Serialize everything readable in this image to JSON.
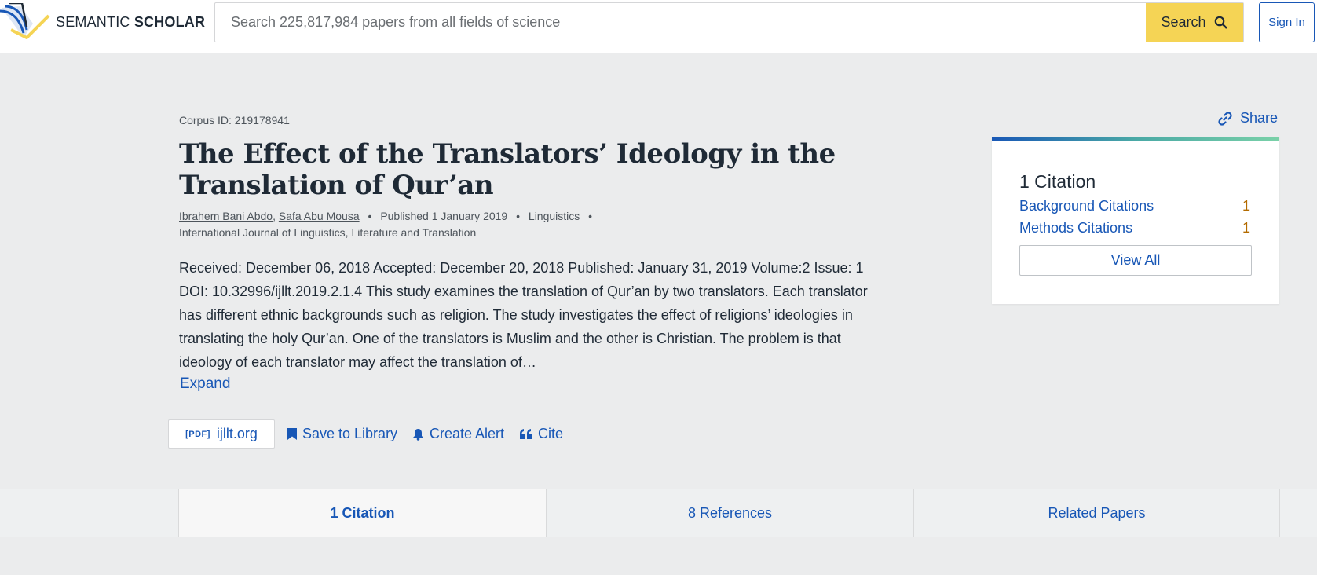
{
  "header": {
    "logo_text_light": "SEMANTIC ",
    "logo_text_bold": "SCHOLAR",
    "search_placeholder": "Search 225,817,984 papers from all fields of science",
    "search_button": "Search",
    "signin_button": "Sign In"
  },
  "paper": {
    "corpus_id": "Corpus ID: 219178941",
    "title": "The Effect of the Translators’ Ideology in the Translation of Qur’an",
    "authors": [
      "Ibrahem Bani Abdo",
      "Safa Abu Mousa"
    ],
    "published": "Published 1 January 2019",
    "field": "Linguistics",
    "venue": "International Journal of Linguistics, Literature and Translation",
    "abstract": "Received: December 06, 2018 Accepted: December 20, 2018 Published: January 31, 2019 Volume:2 Issue: 1 DOI: 10.32996/ijllt.2019.2.1.4 This study examines the translation of Qur’an by two translators. Each translator has different ethnic backgrounds such as religion. The study investigates the effect of religions’ ideologies in translating the holy Qur’an. One of the translators is Muslim and the other is Christian. The problem is that ideology of each translator may affect the translation of…",
    "expand_label": "Expand"
  },
  "actions": {
    "pdf_tag": "[PDF]",
    "pdf_source": "ijllt.org",
    "save": "Save to Library",
    "alert": "Create Alert",
    "cite": "Cite"
  },
  "sidebar": {
    "share": "Share",
    "citation_title": "1 Citation",
    "rows": [
      {
        "label": "Background Citations",
        "count": "1"
      },
      {
        "label": "Methods Citations",
        "count": "1"
      }
    ],
    "view_all": "View All"
  },
  "tabs": [
    {
      "label": "1 Citation"
    },
    {
      "label": "8 References"
    },
    {
      "label": "Related Papers"
    }
  ],
  "colors": {
    "accent": "#1857b6",
    "search_button": "#f5d455",
    "count": "#b36b00",
    "background": "#ebeced"
  }
}
